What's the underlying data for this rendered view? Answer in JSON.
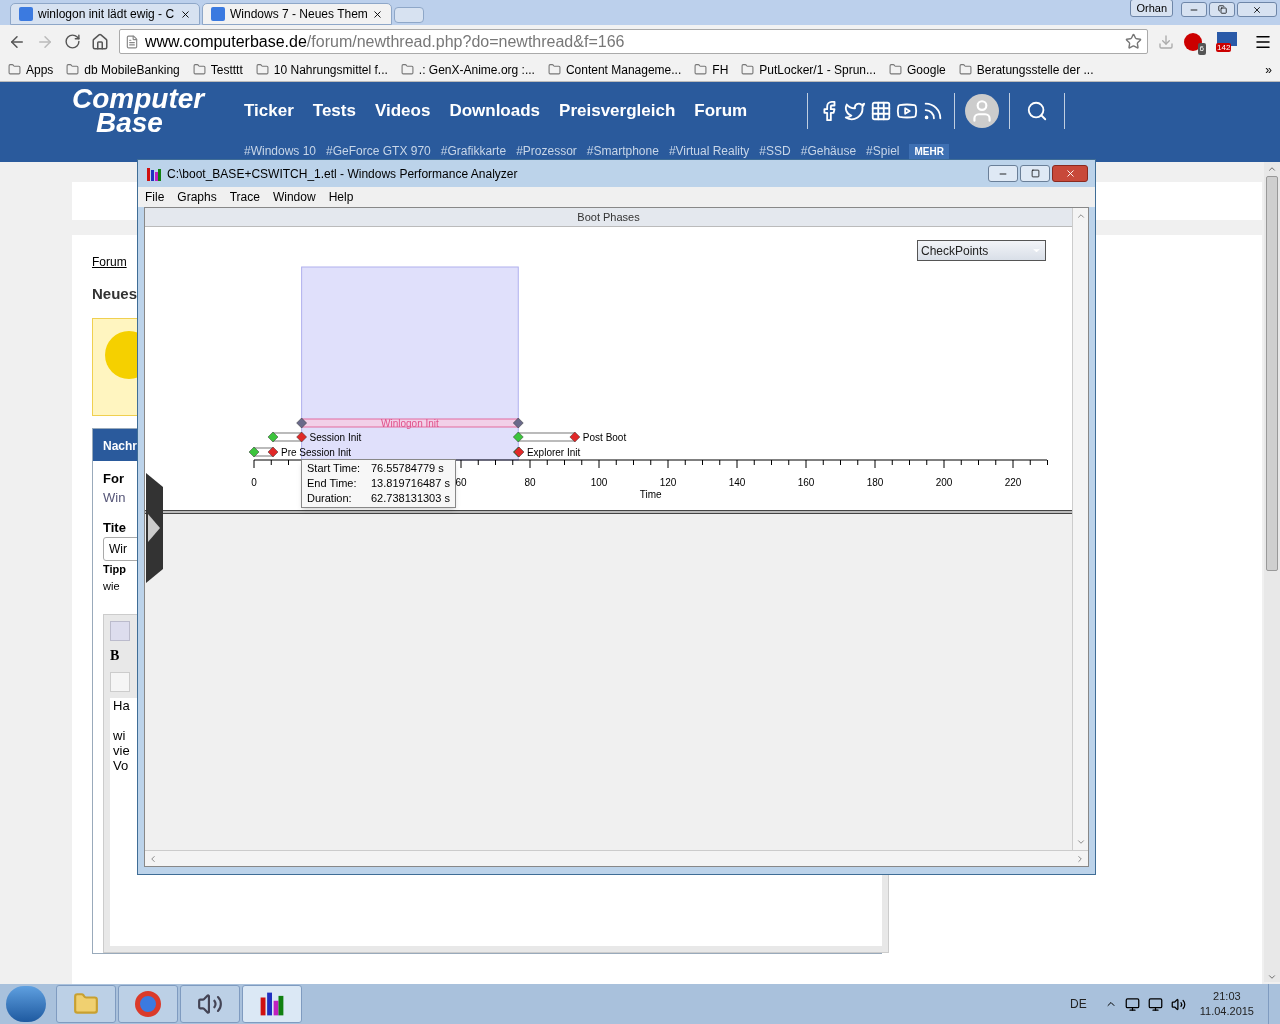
{
  "browser": {
    "tabs": [
      {
        "label": "winlogon init lädt ewig - C",
        "selected": false
      },
      {
        "label": "Windows 7 - Neues Them",
        "selected": true
      }
    ],
    "user": "Orhan",
    "url_host": "www.computerbase.de",
    "url_path": "/forum/newthread.php?do=newthread&f=166",
    "badges": [
      "6",
      "142"
    ],
    "bookmarks": [
      "Apps",
      "db MobileBanking",
      "Testttt",
      "10 Nahrungsmittel f...",
      ".: GenX-Anime.org :...",
      "Content Manageme...",
      "FH",
      "PutLocker/1 - Sprun...",
      "Google",
      "Beratungsstelle der ..."
    ],
    "more": "»"
  },
  "site": {
    "logo": [
      "Computer",
      "Base"
    ],
    "nav": [
      "Ticker",
      "Tests",
      "Videos",
      "Downloads",
      "Preisvergleich",
      "Forum"
    ],
    "tags": [
      "#Windows 10",
      "#GeForce GTX 970",
      "#Grafikkarte",
      "#Prozessor",
      "#Smartphone",
      "#Virtual Reality",
      "#SSD",
      "#Gehäuse",
      "#Spiel"
    ],
    "more": "MEHR"
  },
  "page": {
    "breadcrumb": "Forum",
    "heading": "Neues",
    "panel_title": "Nachr",
    "forum_label": "For",
    "forum_value": "Win",
    "title_label": "Tite",
    "title_value": "Wir",
    "tip_label": "Tipp",
    "tip_text": "wie",
    "toolbar_button": "B",
    "editor_lines": [
      "Ha",
      "wi",
      "vie",
      "Vo"
    ]
  },
  "wpa": {
    "title": "C:\\boot_BASE+CSWITCH_1.etl - Windows Performance Analyzer",
    "menu": [
      "File",
      "Graphs",
      "Trace",
      "Window",
      "Help"
    ],
    "panel_title": "Boot Phases",
    "dropdown": "CheckPoints",
    "phases": [
      {
        "label": "Winlogon Init"
      },
      {
        "label": "Session Init"
      },
      {
        "label": "Post Boot"
      },
      {
        "label": "Pre Session Init"
      },
      {
        "label": "Explorer Init"
      }
    ],
    "axis_labels": [
      "0",
      "60",
      "80",
      "100",
      "120",
      "140",
      "160",
      "180",
      "200",
      "220"
    ],
    "axis_title": "Time",
    "tooltip": [
      {
        "label": "Start Time:",
        "value": "76.55784779 s"
      },
      {
        "label": "End Time:",
        "value": "13.819716487 s"
      },
      {
        "label": "Duration:",
        "value": "62.738131303 s"
      }
    ]
  },
  "taskbar": {
    "language": "DE",
    "time": "21:03",
    "date": "11.04.2015"
  }
}
